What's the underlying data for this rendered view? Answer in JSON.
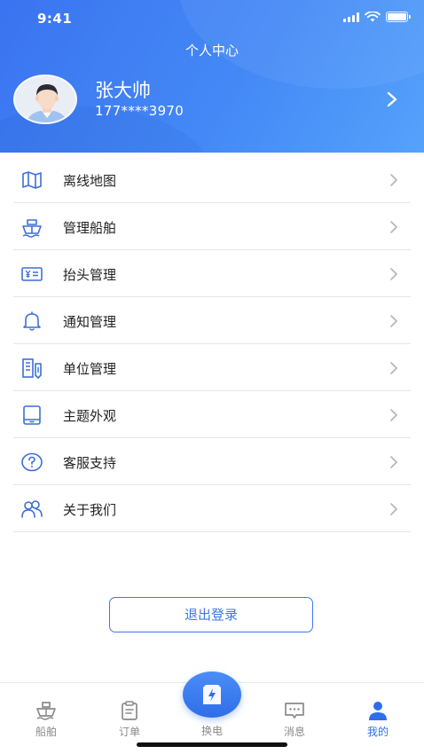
{
  "status_bar": {
    "time": "9:41"
  },
  "header": {
    "title": "个人中心",
    "user_name": "张大帅",
    "user_phone": "177****3970"
  },
  "menu": {
    "items": [
      {
        "label": "离线地图",
        "icon": "map-icon"
      },
      {
        "label": "管理船舶",
        "icon": "ship-icon"
      },
      {
        "label": "抬头管理",
        "icon": "invoice-icon"
      },
      {
        "label": "通知管理",
        "icon": "bell-icon"
      },
      {
        "label": "单位管理",
        "icon": "building-icon"
      },
      {
        "label": "主题外观",
        "icon": "tablet-icon"
      },
      {
        "label": "客服支持",
        "icon": "help-icon"
      },
      {
        "label": "关于我们",
        "icon": "users-icon"
      }
    ]
  },
  "logout_label": "退出登录",
  "tabbar": {
    "tabs": [
      {
        "label": "船舶",
        "icon": "ship-icon"
      },
      {
        "label": "订单",
        "icon": "clipboard-icon"
      },
      {
        "label": "换电",
        "icon": "battery-swap-icon"
      },
      {
        "label": "消息",
        "icon": "message-icon"
      },
      {
        "label": "我的",
        "icon": "person-icon",
        "active": true
      }
    ]
  },
  "colors": {
    "primary": "#2f6ee8",
    "header_gradient_start": "#3a74f0",
    "header_gradient_end": "#55a2fb",
    "icon_blue": "#3c6fd8",
    "divider": "#e6e6e6",
    "inactive_tab": "#8a8a8a"
  }
}
